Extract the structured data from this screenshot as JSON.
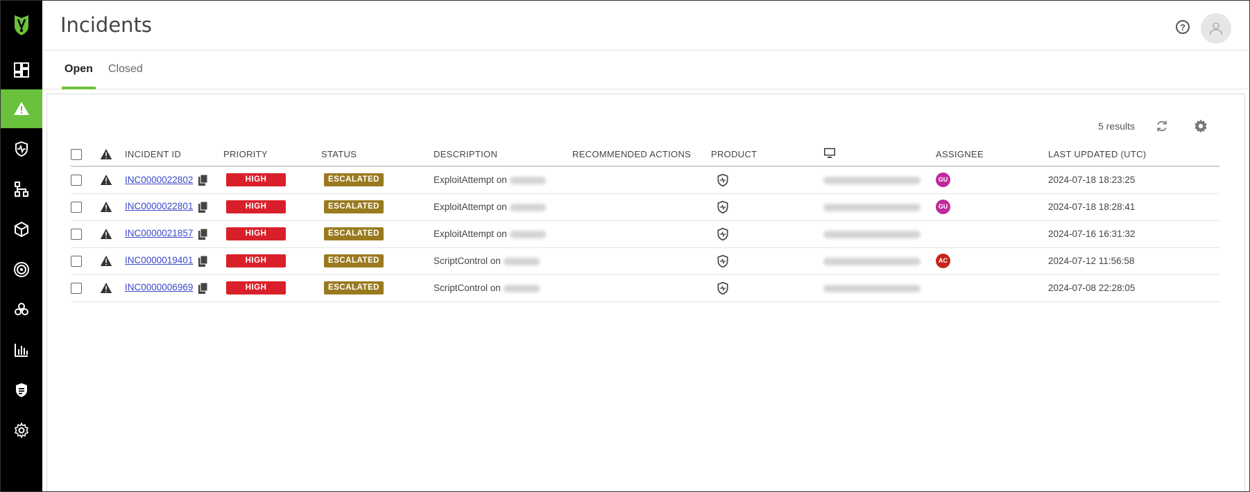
{
  "colors": {
    "accent": "#6ac13c",
    "priority_high": "#d9202a",
    "status_escalated": "#9a7a1f",
    "link": "#3a48c9"
  },
  "sidebar": {
    "logo": "shield-logo-icon",
    "items": [
      {
        "icon": "dashboard-icon",
        "active": false
      },
      {
        "icon": "alert-triangle-icon",
        "active": true
      },
      {
        "icon": "shield-pulse-icon",
        "active": false
      },
      {
        "icon": "network-icon",
        "active": false
      },
      {
        "icon": "cube-icon",
        "active": false
      },
      {
        "icon": "target-icon",
        "active": false
      },
      {
        "icon": "biohazard-icon",
        "active": false
      },
      {
        "icon": "bar-chart-icon",
        "active": false
      },
      {
        "icon": "policy-shield-icon",
        "active": false
      },
      {
        "icon": "gear-icon",
        "active": false
      }
    ]
  },
  "header": {
    "title": "Incidents",
    "help_glyph": "?"
  },
  "tabs": [
    {
      "label": "Open",
      "active": true
    },
    {
      "label": "Closed",
      "active": false
    }
  ],
  "toolbar": {
    "results": "5 results"
  },
  "table": {
    "columns": {
      "incident_id": "INCIDENT ID",
      "priority": "PRIORITY",
      "status": "STATUS",
      "description": "DESCRIPTION",
      "recommended_actions": "RECOMMENDED ACTIONS",
      "product": "PRODUCT",
      "device": "device-monitor-icon",
      "assignee": "ASSIGNEE",
      "last_updated": "LAST UPDATED (UTC)"
    },
    "rows": [
      {
        "id": "INC0000022802",
        "priority": "HIGH",
        "status": "ESCALATED",
        "description": "ExploitAttempt on",
        "assignee": "GU",
        "assignee_color": "#c0299a",
        "updated": "2024-07-18 18:23:25"
      },
      {
        "id": "INC0000022801",
        "priority": "HIGH",
        "status": "ESCALATED",
        "description": "ExploitAttempt on",
        "assignee": "GU",
        "assignee_color": "#c0299a",
        "updated": "2024-07-18 18:28:41"
      },
      {
        "id": "INC0000021857",
        "priority": "HIGH",
        "status": "ESCALATED",
        "description": "ExploitAttempt on",
        "assignee": "",
        "assignee_color": "",
        "updated": "2024-07-16 16:31:32"
      },
      {
        "id": "INC0000019401",
        "priority": "HIGH",
        "status": "ESCALATED",
        "description": "ScriptControl on",
        "assignee": "AC",
        "assignee_color": "#c8261a",
        "updated": "2024-07-12 11:56:58"
      },
      {
        "id": "INC0000006969",
        "priority": "HIGH",
        "status": "ESCALATED",
        "description": "ScriptControl on",
        "assignee": "",
        "assignee_color": "",
        "updated": "2024-07-08 22:28:05"
      }
    ]
  }
}
